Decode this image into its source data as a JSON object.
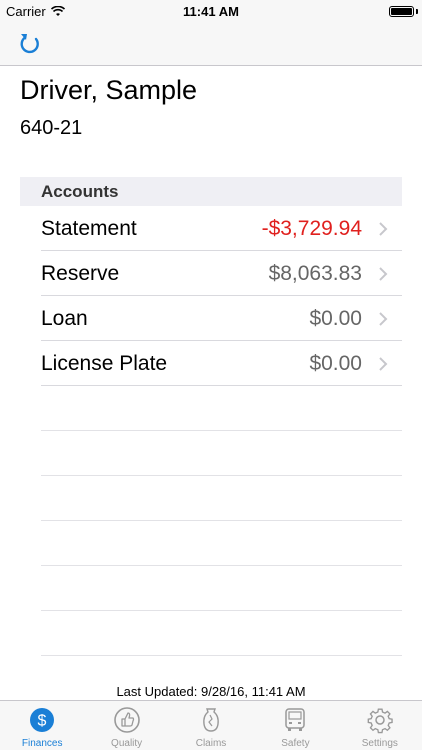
{
  "status_bar": {
    "carrier": "Carrier",
    "time": "11:41 AM"
  },
  "driver": {
    "name": "Driver, Sample",
    "id": "640-21"
  },
  "accounts": {
    "header": "Accounts",
    "rows": [
      {
        "label": "Statement",
        "value": "-$3,729.94",
        "negative": true
      },
      {
        "label": "Reserve",
        "value": "$8,063.83",
        "negative": false
      },
      {
        "label": "Loan",
        "value": "$0.00",
        "negative": false
      },
      {
        "label": "License Plate",
        "value": "$0.00",
        "negative": false
      }
    ]
  },
  "footer": {
    "last_updated": "Last Updated: 9/28/16, 11:41 AM"
  },
  "tabs": [
    {
      "label": "Finances",
      "icon": "dollar-icon",
      "active": true
    },
    {
      "label": "Quality",
      "icon": "thumbs-up-icon",
      "active": false
    },
    {
      "label": "Claims",
      "icon": "broken-vase-icon",
      "active": false
    },
    {
      "label": "Safety",
      "icon": "truck-icon",
      "active": false
    },
    {
      "label": "Settings",
      "icon": "gear-icon",
      "active": false
    }
  ],
  "colors": {
    "accent": "#1a7fd6",
    "negative": "#e0201e",
    "inactive": "#999999"
  }
}
